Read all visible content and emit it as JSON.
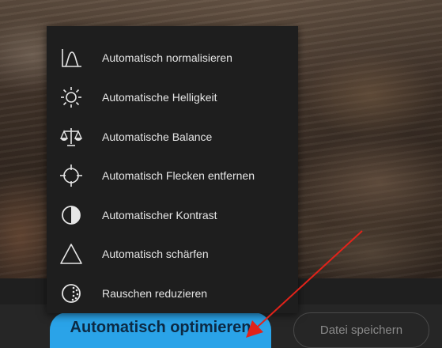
{
  "menu": {
    "items": [
      {
        "label": "Automatisch normalisieren",
        "icon": "normalize-icon"
      },
      {
        "label": "Automatische Helligkeit",
        "icon": "brightness-icon"
      },
      {
        "label": "Automatische Balance",
        "icon": "balance-scale-icon"
      },
      {
        "label": "Automatisch Flecken entfernen",
        "icon": "crosshair-icon"
      },
      {
        "label": "Automatischer Kontrast",
        "icon": "contrast-icon"
      },
      {
        "label": "Automatisch schärfen",
        "icon": "sharpen-triangle-icon"
      },
      {
        "label": "Rauschen reduzieren",
        "icon": "noise-reduction-icon"
      }
    ]
  },
  "footer": {
    "primary_label": "Automatisch optimieren",
    "secondary_label": "Datei speichern"
  },
  "colors": {
    "primary": "#2aa3e8",
    "menu_bg": "#1e1e1e",
    "arrow": "#e2231a"
  }
}
